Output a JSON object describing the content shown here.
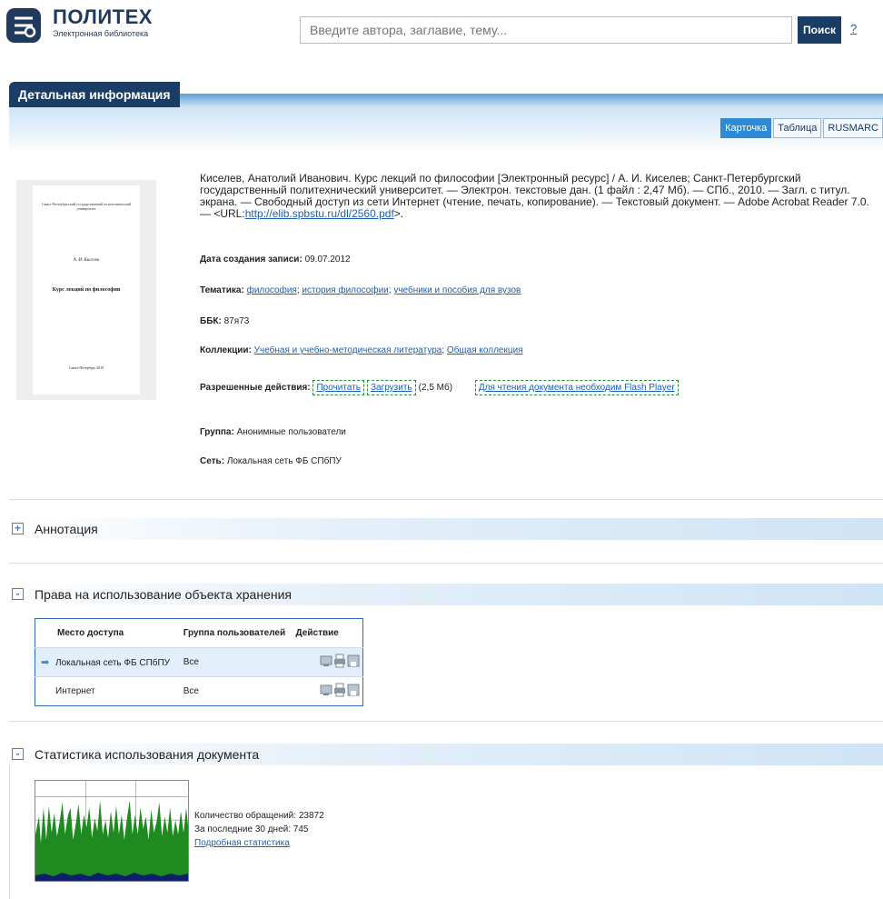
{
  "header": {
    "logo_title": "ПОЛИТЕХ",
    "logo_subtitle": "Электронная библиотека",
    "search_placeholder": "Введите автора, заглавие, тему...",
    "search_button": "Поиск",
    "help_link": "?"
  },
  "detail": {
    "tab_title": "Детальная информация",
    "view_tabs": [
      "Карточка",
      "Таблица",
      "RUSMARC"
    ],
    "description_main": "Киселев, Анатолий Иванович. Курс лекций по философии [Электронный ресурс] / А. И. Киселев; Санкт-Петербургский государственный политехнический университет. — Электрон. текстовые дан. (1 файл : 2,47 Мб). — СПб., 2010. — Загл. с титул. экрана. — Свободный доступ из сети Интернет (чтение, печать, копирование). — Текстовый документ. — Adobe Acrobat Reader 7.0. — <URL:",
    "description_url": "http://elib.spbstu.ru/dl/2560.pdf",
    "description_tail": ">.",
    "cover": {
      "org": "Санкт-Петербургский государственный политехнический университет",
      "author": "А. И. Киселев",
      "title": "Курс лекций по философии",
      "place": "Санкт-Петербург 2010"
    },
    "created_label": "Дата создания записи:",
    "created_value": "09.07.2012",
    "topics_label": "Тематика:",
    "topics": [
      "философия",
      "история философии",
      "учебники и пособия для вузов"
    ],
    "bbk_label": "ББК:",
    "bbk_value": "87я73",
    "collections_label": "Коллекции:",
    "collections": [
      "Учебная и учебно-методическая литература",
      "Общая коллекция"
    ],
    "actions_label": "Разрешенные действия:",
    "action_read": "Прочитать",
    "action_download": "Загрузить",
    "download_size": "(2,5 Мб)",
    "flash_link": "Для чтения документа необходим Flash Player",
    "group_label": "Группа:",
    "group_value": "Анонимные пользователи",
    "network_label": "Сеть:",
    "network_value": "Локальная сеть ФБ СПбПУ"
  },
  "annotation": {
    "title": "Аннотация",
    "toggle": "+"
  },
  "rights": {
    "title": "Права на использование объекта хранения",
    "toggle": "-",
    "headers": [
      "Место доступа",
      "Группа пользователей",
      "Действие"
    ],
    "rows": [
      {
        "place": "Локальная сеть ФБ СПбПУ",
        "group": "Все",
        "current": true
      },
      {
        "place": "Интернет",
        "group": "Все",
        "current": false
      }
    ]
  },
  "stats": {
    "title": "Статистика использования документа",
    "toggle": "-",
    "total_label": "Количество обращений: 23872",
    "last30_label": "За последние 30 дней: 745",
    "details_link": "Подробная статистика"
  },
  "colors": {
    "brand_dark": "#1a3d66",
    "accent": "#2e8ad6",
    "chart_green": "#1f8a1f",
    "chart_navy": "#0b1f6b"
  }
}
